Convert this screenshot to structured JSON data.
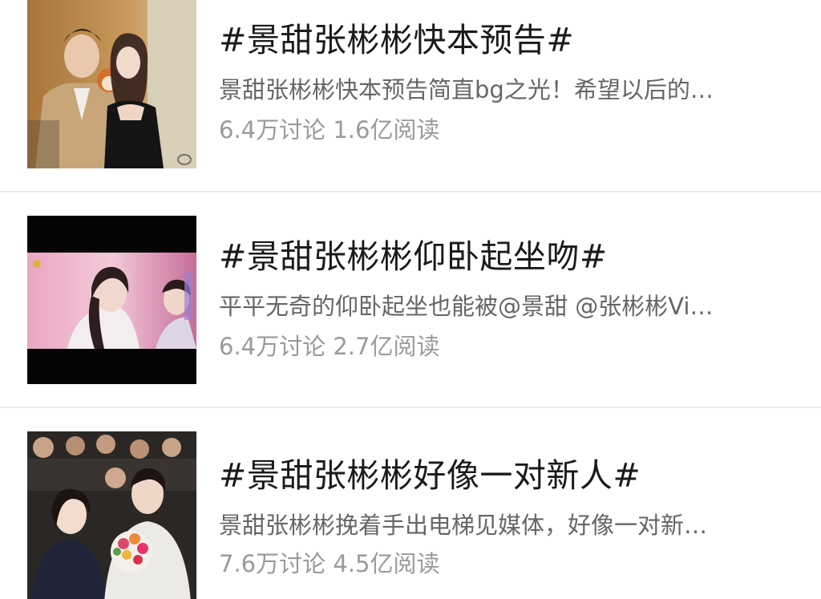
{
  "topics": [
    {
      "title": "#景甜张彬彬快本预告#",
      "description": "景甜张彬彬快本预告简直bg之光！希望以后的…",
      "stats": "6.4万讨论 1.6亿阅读",
      "thumbnail_icon": "couple-photo-image"
    },
    {
      "title": "#景甜张彬彬仰卧起坐吻#",
      "description": "平平无奇的仰卧起坐也能被@景甜 @张彬彬Vi…",
      "stats": "6.4万讨论 2.7亿阅读",
      "thumbnail_icon": "video-still-image"
    },
    {
      "title": "#景甜张彬彬好像一对新人#",
      "description": "景甜张彬彬挽着手出电梯见媒体，好像一对新…",
      "stats": "7.6万讨论 4.5亿阅读",
      "thumbnail_icon": "crowd-bouquet-image"
    }
  ],
  "colors": {
    "title": "#1a1a1a",
    "description": "#666666",
    "stats": "#9a9a9a",
    "divider": "#ececec"
  }
}
